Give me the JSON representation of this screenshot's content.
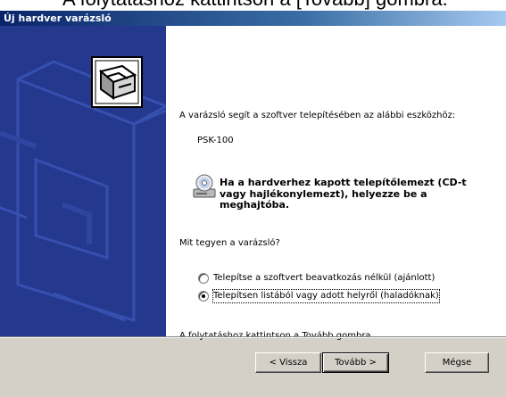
{
  "banner": {
    "text": "A folytatáshoz kattintson a [Tovább] gombra."
  },
  "window": {
    "title": "Új hardver varázsló"
  },
  "content": {
    "intro": "A varázsló segít a szoftver telepítésében az alábbi eszközhöz:",
    "device": "PSK-100",
    "warning": "Ha a hardverhez kapott telepítőlemezt (CD-t\nvagy hajlékonylemezt), helyezze be a\nmeghajtóba.",
    "question": "Mit tegyen a varázsló?",
    "options": [
      {
        "label": "Telepítse a szoftvert beavatkozás nélkül (ajánlott)",
        "selected": false
      },
      {
        "label": "Telepítsen listából vagy adott helyről (haladóknak)",
        "selected": true
      }
    ],
    "footnote": "A folytatáshoz kattintson a Tovább gombra."
  },
  "buttons": {
    "back": "< Vissza",
    "next": "Tovább >",
    "cancel": "Mégse"
  },
  "colors": {
    "title_bar": "#0a246a",
    "side_panel": "#24388d",
    "dialog_face": "#d4d0c8"
  },
  "icons": {
    "side_art": "hardware-box-icon",
    "cd": "cd-drive-icon"
  }
}
